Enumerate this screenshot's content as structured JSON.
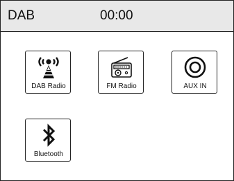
{
  "header": {
    "source": "DAB",
    "time": "00:00"
  },
  "sources": [
    {
      "label": "DAB Radio",
      "icon": "dab-radio-icon"
    },
    {
      "label": "FM Radio",
      "icon": "fm-radio-icon"
    },
    {
      "label": "AUX IN",
      "icon": "aux-in-icon"
    },
    {
      "label": "Bluetooth",
      "icon": "bluetooth-icon"
    }
  ]
}
